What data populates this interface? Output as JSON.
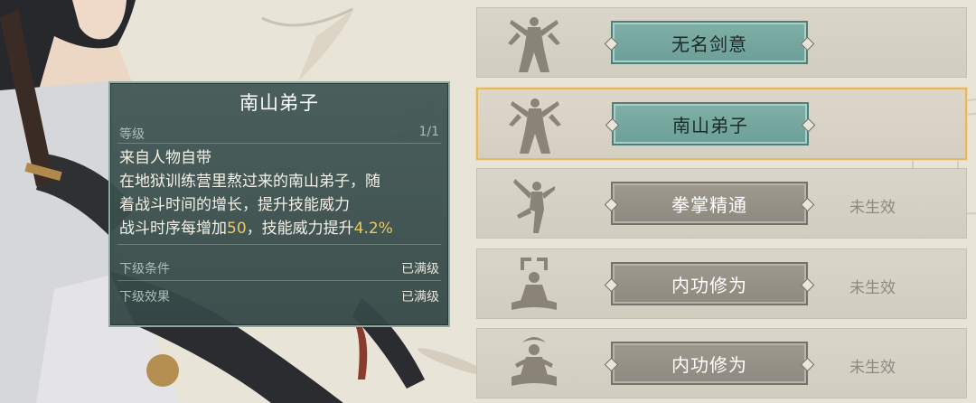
{
  "tooltip": {
    "title": "南山弟子",
    "level_label": "等级",
    "level_value": "1/1",
    "source": "来自人物自带",
    "description_line1": "在地狱训练营里熬过来的南山弟子，随",
    "description_line2": "着战斗时间的增长，提升技能威力",
    "effect_prefix": "战斗时序每增加",
    "effect_value1": "50",
    "effect_middle": "，技能威力提升",
    "effect_value2": "4.2%",
    "next_condition_label": "下级条件",
    "next_condition_value": "已满级",
    "next_effect_label": "下级效果",
    "next_effect_value": "已满级"
  },
  "skills": [
    {
      "name": "无名剑意",
      "state": "active",
      "status": "",
      "icon": "swordsman-silhouette-icon"
    },
    {
      "name": "南山弟子",
      "state": "active",
      "status": "",
      "icon": "swordsman-silhouette-icon"
    },
    {
      "name": "拳掌精通",
      "state": "inactive",
      "status": "未生效",
      "icon": "martial-stance-icon"
    },
    {
      "name": "内功修为",
      "state": "inactive",
      "status": "未生效",
      "icon": "meditation-icon"
    },
    {
      "name": "内功修为",
      "state": "inactive",
      "status": "未生效",
      "icon": "meditation-aura-icon"
    }
  ],
  "colors": {
    "active_button": "#6c9f97",
    "inactive_button": "#8f8a80",
    "selected_border": "#e3b867",
    "highlight_text": "#e9c96a"
  }
}
